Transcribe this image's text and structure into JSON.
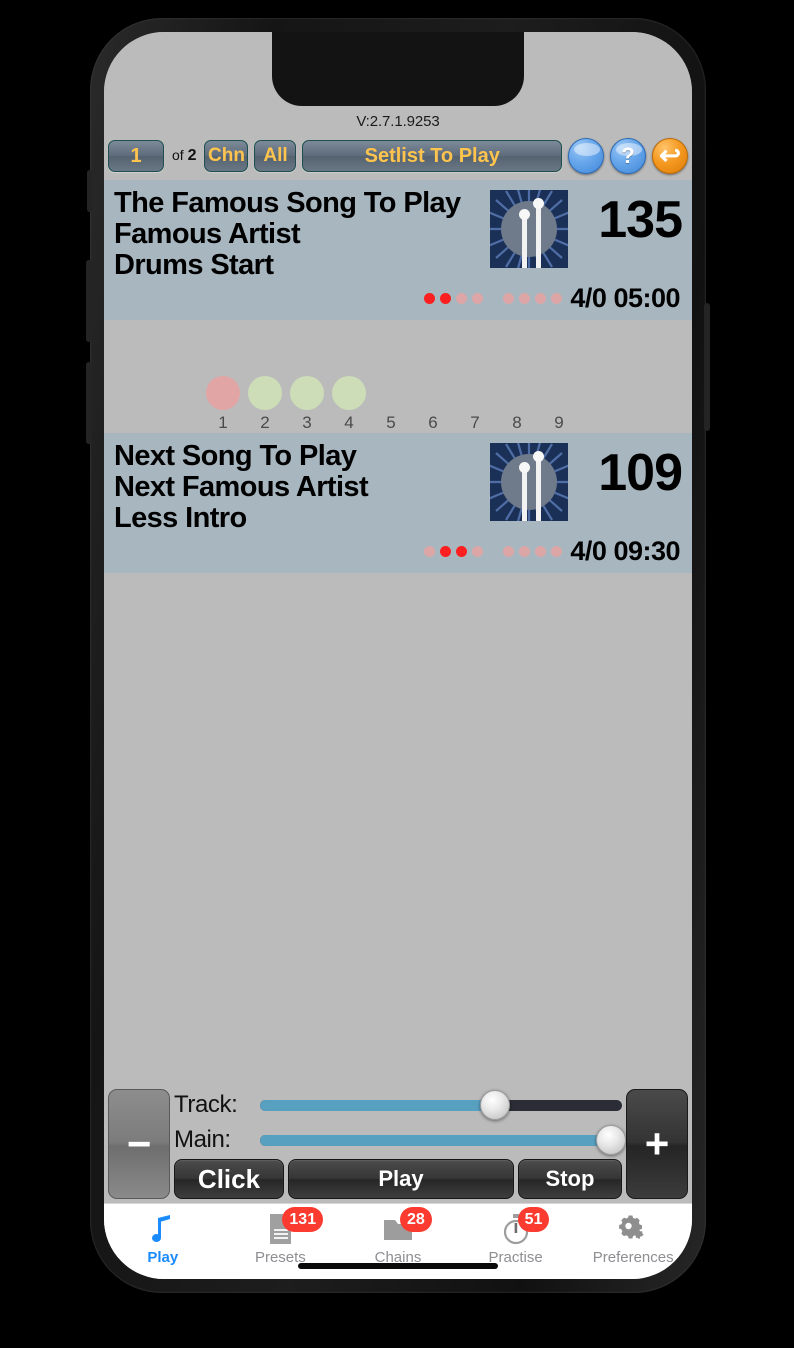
{
  "app": {
    "version_label": "V:2.7.1.9253"
  },
  "toolbar": {
    "page_number": "1",
    "of_prefix": "of",
    "page_total": "2",
    "chn_label": "Chn",
    "all_label": "All",
    "setlist_label": "Setlist To Play",
    "blank_button_label": "",
    "help_label": "?",
    "undo_label": "↩"
  },
  "songs": [
    {
      "title": "The Famous Song To Play",
      "artist": "Famous Artist",
      "note": "Drums Start",
      "bpm": "135",
      "bars_time": "4/0 05:00",
      "icon": "drumsticks-icon",
      "beat_dots": [
        {
          "state": "on"
        },
        {
          "state": "on"
        },
        {
          "state": "off"
        },
        {
          "state": "off"
        },
        {
          "state": "gap"
        },
        {
          "state": "off"
        },
        {
          "state": "off"
        },
        {
          "state": "off"
        },
        {
          "state": "off"
        }
      ]
    },
    {
      "title": "Next Song To Play",
      "artist": "Next Famous Artist",
      "note": "Less Intro",
      "bpm": "109",
      "bars_time": "4/0 09:30",
      "icon": "drumsticks-icon",
      "beat_dots": [
        {
          "state": "off"
        },
        {
          "state": "on"
        },
        {
          "state": "on"
        },
        {
          "state": "off"
        },
        {
          "state": "gap"
        },
        {
          "state": "off"
        },
        {
          "state": "off"
        },
        {
          "state": "off"
        },
        {
          "state": "off"
        }
      ]
    }
  ],
  "sections": [
    {
      "num": "1",
      "color": "red"
    },
    {
      "num": "2",
      "color": "green"
    },
    {
      "num": "3",
      "color": "green"
    },
    {
      "num": "4",
      "color": "green"
    },
    {
      "num": "5",
      "color": "empty"
    },
    {
      "num": "6",
      "color": "empty"
    },
    {
      "num": "7",
      "color": "empty"
    },
    {
      "num": "8",
      "color": "empty"
    },
    {
      "num": "9",
      "color": "empty"
    }
  ],
  "transport": {
    "minus_label": "−",
    "plus_label": "+",
    "track_label": "Track:",
    "track_value": 65,
    "main_label": "Main:",
    "main_value": 97,
    "click_label": "Click",
    "play_label": "Play",
    "stop_label": "Stop"
  },
  "tabbar": {
    "items": [
      {
        "label": "Play",
        "icon": "music-note-icon",
        "badge": "",
        "active": true
      },
      {
        "label": "Presets",
        "icon": "document-icon",
        "badge": "131",
        "active": false
      },
      {
        "label": "Chains",
        "icon": "folder-icon",
        "badge": "28",
        "active": false
      },
      {
        "label": "Practise",
        "icon": "stopwatch-icon",
        "badge": "51",
        "active": false
      },
      {
        "label": "Preferences",
        "icon": "gears-icon",
        "badge": "",
        "active": false
      }
    ]
  },
  "colors": {
    "accent_blue": "#1a8cff",
    "badge_red": "#fb3b30",
    "card_bg": "#a8b6c0",
    "screen_bg": "#bbbbbb",
    "button_gold": "#ffc44d",
    "slider_fill": "#58a0c0"
  }
}
